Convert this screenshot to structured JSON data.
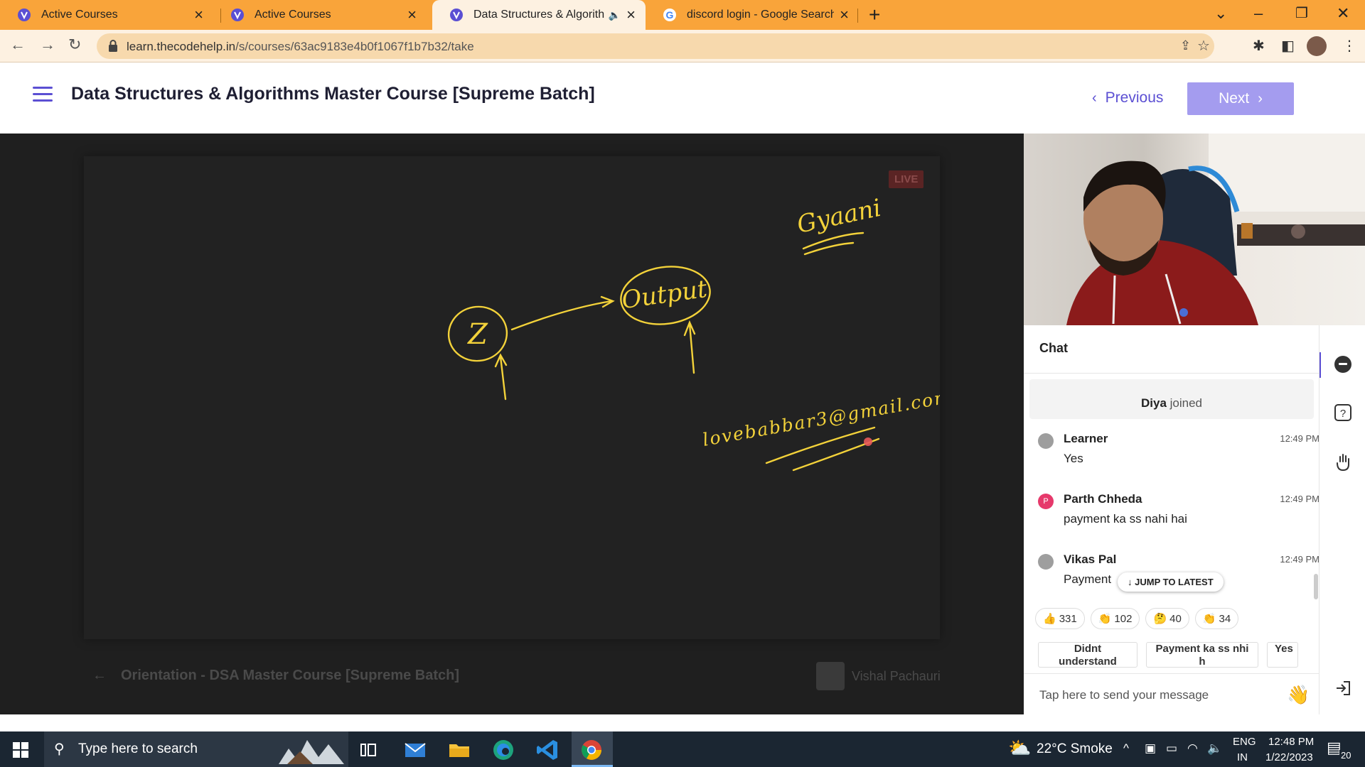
{
  "browser": {
    "tabs": [
      {
        "title": "Active Courses",
        "active": false
      },
      {
        "title": "Active Courses",
        "active": false
      },
      {
        "title": "Data Structures & Algorithm",
        "active": true,
        "audio": true
      },
      {
        "title": "discord login - Google Search",
        "active": false
      }
    ],
    "url_host": "learn.thecodehelp.in",
    "url_path": "/s/courses/63ac9183e4b0f1067f1b7b32/take"
  },
  "header": {
    "course_title": "Data Structures & Algorithms Master Course [Supreme Batch]",
    "previous_label": "Previous",
    "next_label": "Next"
  },
  "player": {
    "live_badge": "LIVE",
    "board_text": {
      "top_right": "Gyaani",
      "center_node": "Z",
      "output_node": "Output",
      "email": "lovebabbar3@gmail.com"
    },
    "prev_lecture": "Orientation - DSA Master Course [Supreme Batch]",
    "instructor": "Vishal Pachauri"
  },
  "chat": {
    "title": "Chat",
    "joined_name": "Diya",
    "joined_text": "joined",
    "messages": [
      {
        "name": "Learner",
        "time": "12:49 PM",
        "text": "Yes",
        "avatar": ""
      },
      {
        "name": "Parth Chheda",
        "time": "12:49 PM",
        "text": "payment ka ss nahi hai",
        "avatar": "P"
      },
      {
        "name": "Vikas Pal",
        "time": "12:49 PM",
        "text": "Payment",
        "avatar": ""
      }
    ],
    "jump_label": "JUMP TO LATEST",
    "reactions": [
      {
        "emoji": "👍",
        "count": "331"
      },
      {
        "emoji": "👏",
        "count": "102"
      },
      {
        "emoji": "🤔",
        "count": "40"
      },
      {
        "emoji": "👏",
        "count": "34"
      }
    ],
    "quick_replies": [
      "Didnt understand",
      "Payment ka ss nhi h",
      "Yes"
    ],
    "input_placeholder": "Tap here to send your message",
    "wave_emoji": "👋"
  },
  "taskbar": {
    "search_placeholder": "Type here to search",
    "weather": "22°C  Smoke",
    "lang": "ENG",
    "region": "IN",
    "time": "12:48 PM",
    "date": "1/22/2023",
    "notifications": "20"
  },
  "colors": {
    "tab_strip": "#f9a43a",
    "accent": "#5b4fd3",
    "next_button": "#a49cef",
    "ink": "#f3d23a"
  }
}
